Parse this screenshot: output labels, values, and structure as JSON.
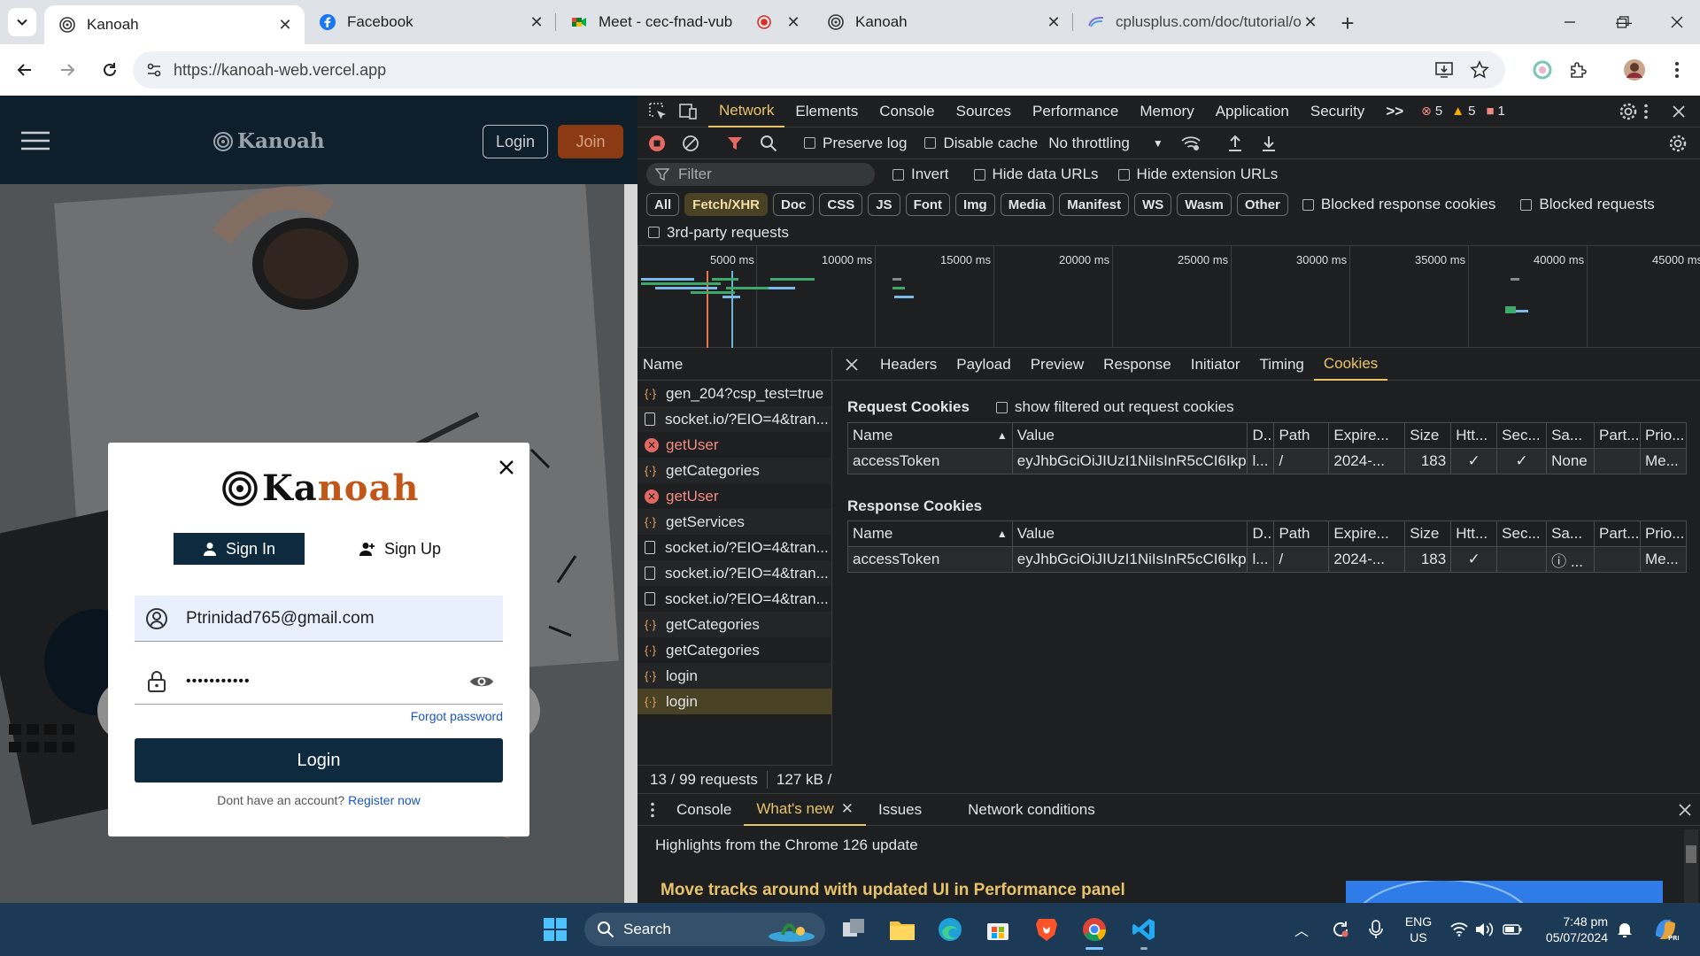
{
  "browser": {
    "tabs": [
      {
        "title": "Kanoah",
        "active": true
      },
      {
        "title": "Facebook",
        "active": false
      },
      {
        "title": "Meet - cec-fnad-vub",
        "active": false
      },
      {
        "title": "Kanoah",
        "active": false
      },
      {
        "title": "cplusplus.com/doc/tutorial/ope",
        "active": false
      }
    ],
    "url": "https://kanoah-web.vercel.app"
  },
  "site": {
    "brand": "Kanoah",
    "brand_main": "Ka",
    "brand_accent": "noah",
    "login_label": "Login",
    "join_label": "Join",
    "modal": {
      "signin_tab": "Sign In",
      "signup_tab": "Sign Up",
      "email": "Ptrinidad765@gmail.com",
      "password_mask": "•••••••••••",
      "forgot": "Forgot password",
      "login_button": "Login",
      "no_account": "Dont have an account?",
      "register": "Register now"
    },
    "colors": {
      "header": "#0e1e2b",
      "accent": "#c2571a",
      "primary": "#0e2a3f"
    }
  },
  "devtools": {
    "panels": [
      "Network",
      "Elements",
      "Console",
      "Sources",
      "Performance",
      "Memory",
      "Application",
      "Security"
    ],
    "more": ">>",
    "errors": "5",
    "warnings": "5",
    "issues": "1",
    "preserve_log": "Preserve log",
    "disable_cache": "Disable cache",
    "throttling": "No throttling",
    "filter_placeholder": "Filter",
    "invert": "Invert",
    "hide_data_urls": "Hide data URLs",
    "hide_ext_urls": "Hide extension URLs",
    "type_filters": [
      "All",
      "Fetch/XHR",
      "Doc",
      "CSS",
      "JS",
      "Font",
      "Img",
      "Media",
      "Manifest",
      "WS",
      "Wasm",
      "Other"
    ],
    "blocked_cookies": "Blocked response cookies",
    "blocked_requests": "Blocked requests",
    "third_party": "3rd-party requests",
    "timeline_ticks": [
      "5000 ms",
      "10000 ms",
      "15000 ms",
      "20000 ms",
      "25000 ms",
      "30000 ms",
      "35000 ms",
      "40000 ms",
      "45000 ms"
    ],
    "name_header": "Name",
    "requests": [
      {
        "name": "gen_204?csp_test=true",
        "type": "xhr"
      },
      {
        "name": "socket.io/?EIO=4&tran...",
        "type": "doc"
      },
      {
        "name": "getUser",
        "type": "error"
      },
      {
        "name": "getCategories",
        "type": "xhr"
      },
      {
        "name": "getUser",
        "type": "error"
      },
      {
        "name": "getServices",
        "type": "xhr"
      },
      {
        "name": "socket.io/?EIO=4&tran...",
        "type": "doc"
      },
      {
        "name": "socket.io/?EIO=4&tran...",
        "type": "doc"
      },
      {
        "name": "socket.io/?EIO=4&tran...",
        "type": "doc"
      },
      {
        "name": "getCategories",
        "type": "xhr"
      },
      {
        "name": "getCategories",
        "type": "xhr"
      },
      {
        "name": "login",
        "type": "xhr"
      },
      {
        "name": "login",
        "type": "xhr",
        "selected": true
      }
    ],
    "detail_tabs": [
      "Headers",
      "Payload",
      "Preview",
      "Response",
      "Initiator",
      "Timing",
      "Cookies"
    ],
    "request_cookies_title": "Request Cookies",
    "show_filtered": "show filtered out request cookies",
    "response_cookies_title": "Response Cookies",
    "cookie_columns": [
      "Name",
      "Value",
      "D..",
      "Path",
      "Expire...",
      "Size",
      "Htt...",
      "Sec...",
      "Sa...",
      "Part...",
      "Prio..."
    ],
    "request_cookies": [
      [
        "accessToken",
        "eyJhbGciOiJIUzI1NiIsInR5cCI6Ikp...",
        "l...",
        "/",
        "2024-...",
        "183",
        "✓",
        "✓",
        "None",
        "",
        "Me..."
      ]
    ],
    "response_cookies": [
      [
        "accessToken",
        "eyJhbGciOiJIUzI1NiIsInR5cCI6Ikp...",
        "l...",
        "/",
        "2024-...",
        "183",
        "✓",
        "",
        "ⓘ ...",
        "",
        "Me..."
      ]
    ],
    "status_requests": "13 / 99 requests",
    "status_size": "127 kB /",
    "drawer_tabs": [
      "Console",
      "What's new",
      "Issues",
      "Network conditions"
    ],
    "drawer_heading": "Highlights from the Chrome 126 update",
    "drawer_feature": "Move tracks around with updated UI in Performance panel"
  },
  "taskbar": {
    "search_label": "Search",
    "lang": "ENG",
    "region": "US",
    "time": "7:48 pm",
    "date": "05/07/2024"
  }
}
